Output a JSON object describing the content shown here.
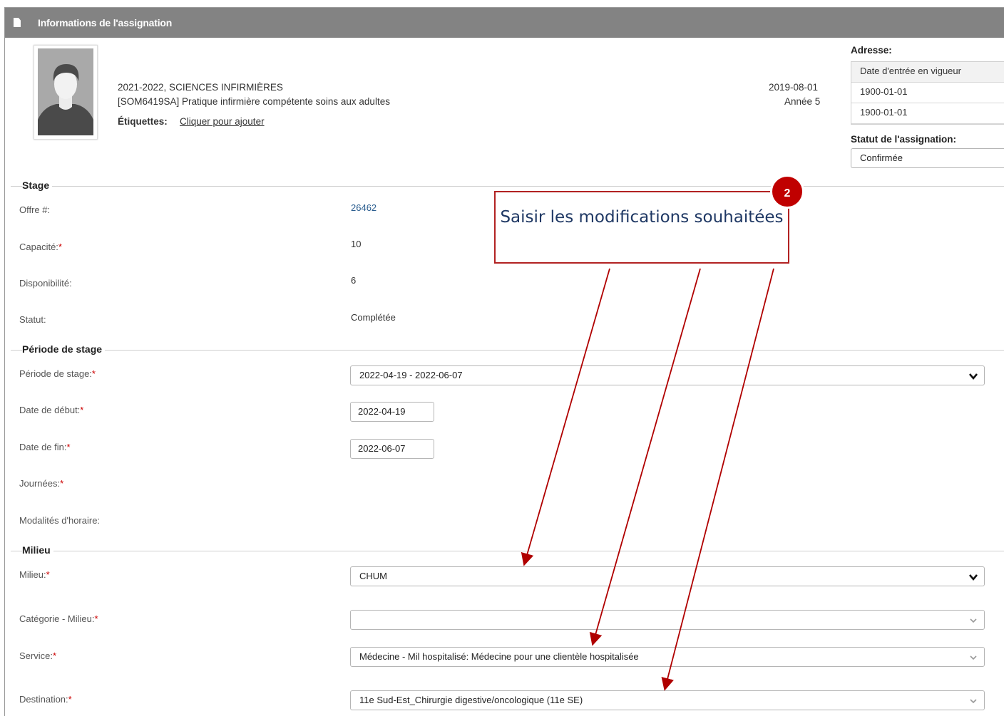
{
  "header": {
    "title": "Informations de l'assignation",
    "icon": "document-icon"
  },
  "student": {
    "program": "2021-2022, SCIENCES INFIRMIÈRES",
    "course": "[SOM6419SA] Pratique infirmière compétente soins aux adultes",
    "tags_label": "Étiquettes:",
    "tags_link": "Cliquer pour ajouter",
    "date": "2019-08-01",
    "year": "Année 5"
  },
  "address": {
    "label": "Adresse:",
    "table_header": "Date d'entrée en vigueur",
    "rows": [
      "1900-01-01",
      "1900-01-01"
    ]
  },
  "assignment_status": {
    "label": "Statut de l'assignation:",
    "value": "Confirmée"
  },
  "stage": {
    "section": "Stage",
    "offer_label": "Offre #:",
    "offer_value": "26462",
    "capacity_label": "Capacité:",
    "capacity_value": "10",
    "availability_label": "Disponibilité:",
    "availability_value": "6",
    "status_label": "Statut:",
    "status_value": "Complétée"
  },
  "period": {
    "section": "Période de stage",
    "period_label": "Période de stage:",
    "period_value": "2022-04-19 - 2022-06-07",
    "start_label": "Date de début:",
    "start_value": "2022-04-19",
    "end_label": "Date de fin:",
    "end_value": "2022-06-07",
    "days_label": "Journées:",
    "schedule_label": "Modalités d'horaire:"
  },
  "milieu": {
    "section": "Milieu",
    "milieu_label": "Milieu:",
    "milieu_value": "CHUM",
    "category_label": "Catégorie - Milieu:",
    "category_value": "",
    "service_label": "Service:",
    "service_value": "Médecine - Mil hospitalisé: Médecine pour une clientèle hospitalisée",
    "destination_label": "Destination:",
    "destination_value": "11e Sud-Est_Chirurgie digestive/oncologique (11e SE)"
  },
  "annotation": {
    "text": "Saisir les modifications souhaitées",
    "step": "2"
  },
  "required_mark": "*",
  "colors": {
    "header_bg": "#838383",
    "callout_border": "#b22222",
    "badge": "#c00000",
    "callout_text": "#1f3864"
  }
}
